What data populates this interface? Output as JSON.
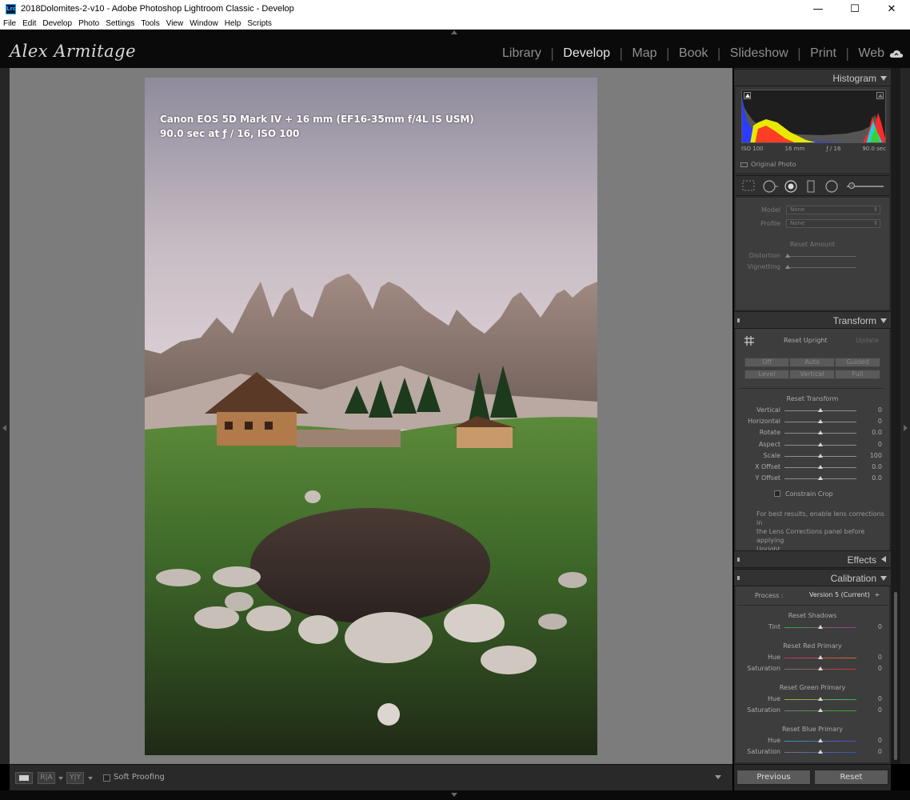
{
  "window": {
    "title": "2018Dolomites-2-v10 - Adobe Photoshop Lightroom Classic - Develop",
    "app_icon_text": "Lrc",
    "minimize": "—",
    "maximize": "☐",
    "close": "✕"
  },
  "menu": [
    "File",
    "Edit",
    "Develop",
    "Photo",
    "Settings",
    "Tools",
    "View",
    "Window",
    "Help",
    "Scripts"
  ],
  "identity_plate": "Alex Armitage",
  "modules": [
    {
      "label": "Library",
      "active": false
    },
    {
      "label": "Develop",
      "active": true
    },
    {
      "label": "Map",
      "active": false
    },
    {
      "label": "Book",
      "active": false
    },
    {
      "label": "Slideshow",
      "active": false
    },
    {
      "label": "Print",
      "active": false
    },
    {
      "label": "Web",
      "active": false
    }
  ],
  "photo_info": {
    "line1": "Canon EOS 5D Mark IV + 16 mm (EF16-35mm f/4L IS USM)",
    "line2": "90.0 sec at ƒ / 16, ISO 100"
  },
  "toolbar": {
    "compare_label_1": "R|A",
    "compare_label_2": "Y|Y",
    "soft_proofing": "Soft Proofing"
  },
  "histogram": {
    "title": "Histogram",
    "iso": "ISO 100",
    "focal": "16 mm",
    "aperture": "ƒ / 16",
    "shutter": "90.0 sec",
    "original_photo": "Original Photo",
    "colors": {
      "blue": "#2a3cff",
      "yellow": "#e8e800",
      "red": "#ff2a2a",
      "cyan": "#20d0e0",
      "green": "#39d039",
      "gray": "#8c8c8c"
    }
  },
  "lens": {
    "model_label": "Model",
    "model_value": "None",
    "profile_label": "Profile",
    "profile_value": "None",
    "reset_amount": "Reset Amount",
    "distortion": "Distortion",
    "vignetting": "Vignetting"
  },
  "transform": {
    "title": "Transform",
    "reset_upright": "Reset Upright",
    "update": "Update",
    "upright_buttons": [
      "Off",
      "Auto",
      "Guided",
      "Level",
      "Vertical",
      "Full"
    ],
    "reset_transform": "Reset Transform",
    "sliders": [
      {
        "label": "Vertical",
        "value": "0"
      },
      {
        "label": "Horizontal",
        "value": "0"
      },
      {
        "label": "Rotate",
        "value": "0.0"
      },
      {
        "label": "Aspect",
        "value": "0"
      },
      {
        "label": "Scale",
        "value": "100"
      },
      {
        "label": "X Offset",
        "value": "0.0"
      },
      {
        "label": "Y Offset",
        "value": "0.0"
      }
    ],
    "constrain_crop": "Constrain Crop",
    "note_line1": "For best results, enable lens corrections in",
    "note_line2": "the Lens Corrections panel before applying",
    "note_line3": "Upright."
  },
  "effects": {
    "title": "Effects"
  },
  "calibration": {
    "title": "Calibration",
    "process_label": "Process :",
    "process_value": "Version 5 (Current)",
    "process_arrows": "÷",
    "reset_shadows": "Reset Shadows",
    "tint_label": "Tint",
    "tint_value": "0",
    "reset_red": "Reset Red Primary",
    "reset_green": "Reset Green Primary",
    "reset_blue": "Reset Blue Primary",
    "hue_label": "Hue",
    "saturation_label": "Saturation",
    "red_hue": "0",
    "red_sat": "0",
    "green_hue": "0",
    "green_sat": "0",
    "blue_hue": "0",
    "blue_sat": "0"
  },
  "buttons": {
    "previous": "Previous",
    "reset": "Reset"
  }
}
